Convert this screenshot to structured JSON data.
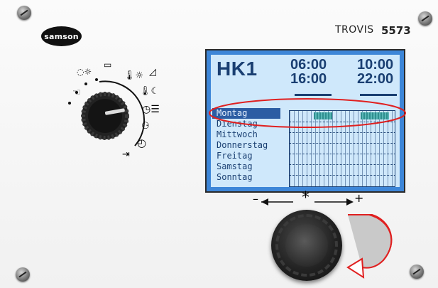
{
  "brand": {
    "logo": "samson",
    "product": "TROVIS",
    "model": "5573"
  },
  "display": {
    "circuit": "HK1",
    "times": [
      "06:00",
      "10:00",
      "16:00",
      "22:00"
    ],
    "days": [
      "Montag",
      "Dienstag",
      "Mittwoch",
      "Donnerstag",
      "Freitag",
      "Samstag",
      "Sonntag"
    ],
    "selected_day": "Montag"
  },
  "rotary": {
    "left_label": "–",
    "center_label": "*",
    "right_label": "+"
  },
  "colors": {
    "lcd_bg": "#cfe8fb",
    "lcd_frame": "#3d86d8",
    "text": "#1a3f72",
    "highlight_ring": "#e02020"
  }
}
